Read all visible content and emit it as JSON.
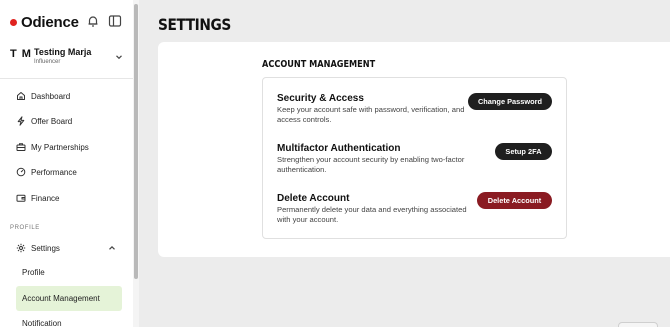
{
  "brand": {
    "name": "Odience",
    "accent_color": "#e0231f"
  },
  "header_icons": {
    "notifications": "bell-icon",
    "toggle": "sidebar-toggle-icon"
  },
  "user": {
    "initials": "T M",
    "name": "Testing Marja",
    "role": "Influencer"
  },
  "nav": [
    {
      "label": "Dashboard",
      "icon": "home-icon"
    },
    {
      "label": "Offer Board",
      "icon": "bolt-icon"
    },
    {
      "label": "My Partnerships",
      "icon": "briefcase-icon"
    },
    {
      "label": "Performance",
      "icon": "gauge-icon"
    },
    {
      "label": "Finance",
      "icon": "wallet-icon"
    }
  ],
  "profile_section": {
    "label": "PROFILE",
    "settings": {
      "label": "Settings",
      "icon": "gear-icon",
      "expanded": true
    },
    "sub_items": [
      {
        "label": "Profile",
        "active": false
      },
      {
        "label": "Account Management",
        "active": true
      },
      {
        "label": "Notification",
        "active": false
      }
    ]
  },
  "page": {
    "title": "SETTINGS",
    "section_heading": "ACCOUNT MANAGEMENT",
    "rows": [
      {
        "title": "Security & Access",
        "description": "Keep your account safe with password, verification, and access controls.",
        "button": "Change Password"
      },
      {
        "title": "Multifactor Authentication",
        "description": "Strengthen your account security by enabling two-factor authentication.",
        "button": "Setup 2FA"
      },
      {
        "title": "Delete Account",
        "description": "Permanently delete your data and everything associated with your account.",
        "button": "Delete Account"
      }
    ]
  },
  "colors": {
    "active_nav_bg": "#e5f3d8",
    "danger": "#8a1b22",
    "dark_button": "#1f1f1f"
  }
}
